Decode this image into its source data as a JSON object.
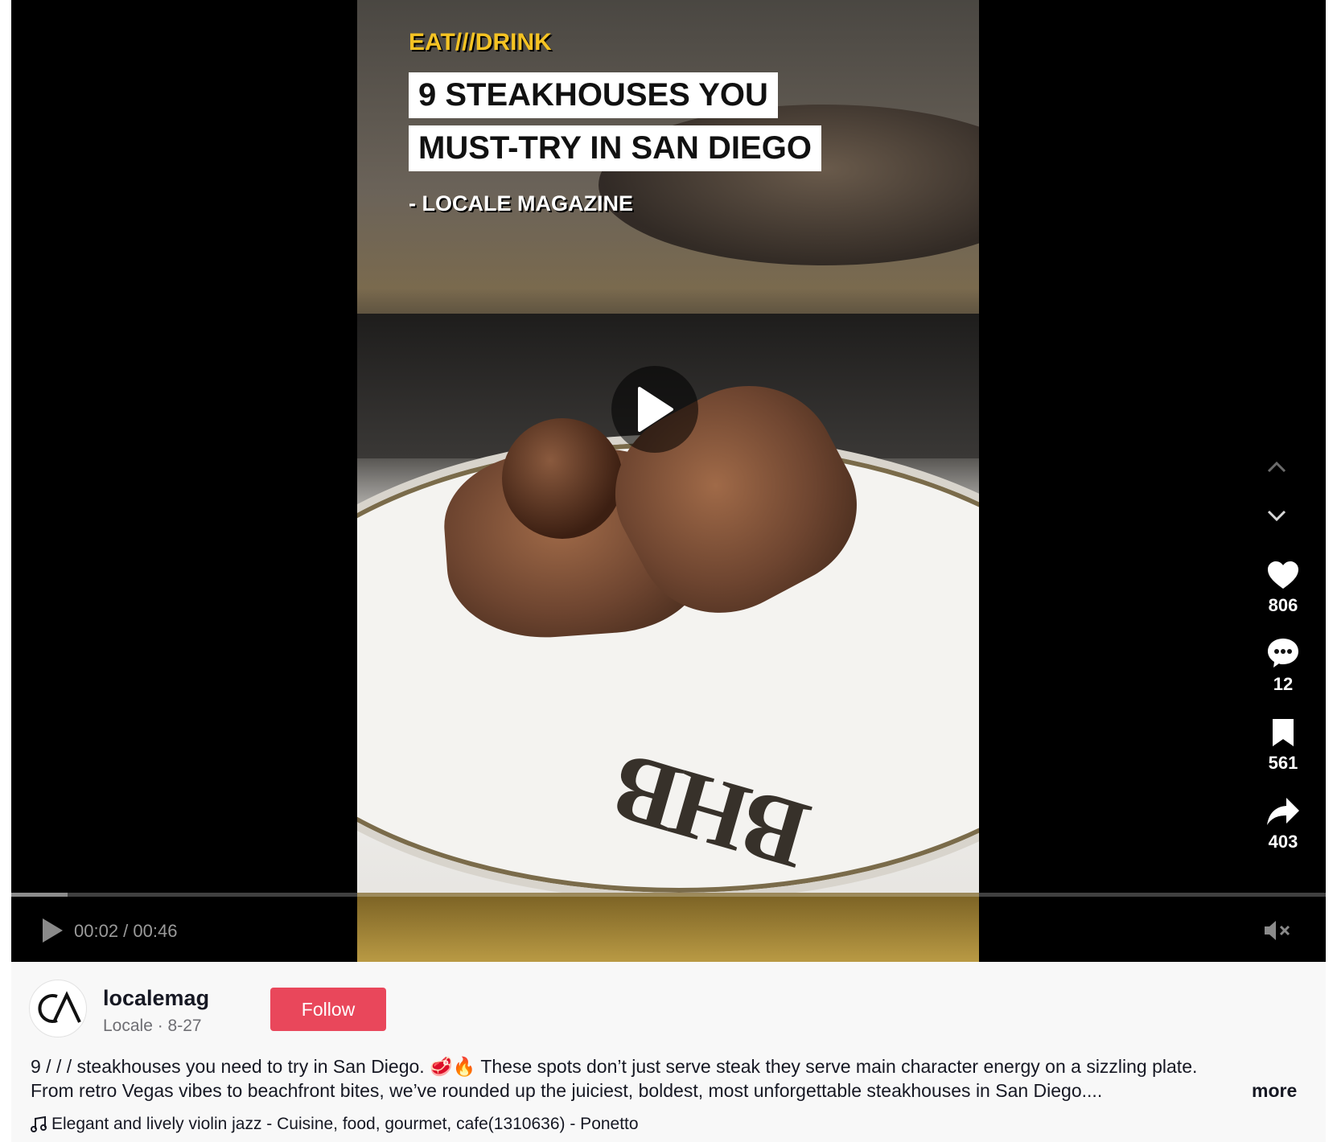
{
  "video": {
    "category_label": "EAT///DRINK",
    "title_line1": "9 STEAKHOUSES YOU",
    "title_line2": "MUST-TRY IN SAN DIEGO",
    "byline": "- LOCALE MAGAZINE",
    "plate_monogram": "BHB",
    "current_time": "00:02",
    "duration": "00:46",
    "time_text": "00:02 / 00:46",
    "progress_fraction": 0.043
  },
  "actions": {
    "likes": "806",
    "comments": "12",
    "saves": "561",
    "shares": "403"
  },
  "author": {
    "username": "localemag",
    "meta": "Locale · 8-27",
    "follow_label": "Follow"
  },
  "description": {
    "line1": "9 / / / steakhouses you need to try in San Diego. 🥩🔥 These spots don’t just serve steak they serve main character energy on a sizzling plate.",
    "line2": "From retro Vegas vibes to beachfront bites, we’ve rounded up the juiciest, boldest, most unforgettable steakhouses in San Diego....",
    "more_label": "more"
  },
  "music": {
    "title": "Elegant and lively violin jazz - Cuisine, food, gourmet, cafe(1310636) - Ponetto"
  },
  "icons": [
    "play-icon",
    "mute-icon",
    "chevron-up-icon",
    "chevron-down-icon",
    "heart-icon",
    "comment-icon",
    "bookmark-icon",
    "share-icon",
    "music-note-icon"
  ],
  "colors": {
    "follow_button": "#e9475b",
    "category_label": "#f5c323",
    "info_background": "#f8f8f8"
  }
}
